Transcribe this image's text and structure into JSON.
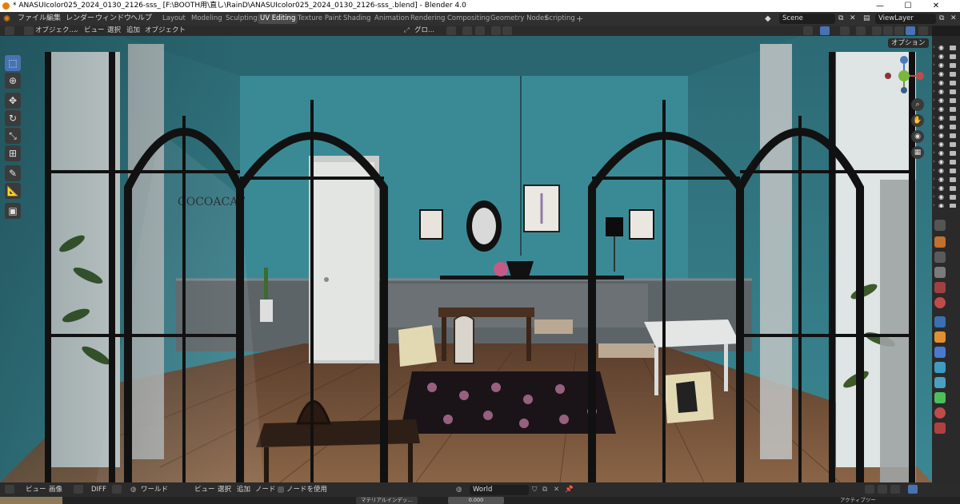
{
  "window": {
    "title": "* ANASUIcolor025_2024_0130_2126-sss_ [F:\\BOOTH用\\直し\\RainD\\ANASUIcolor025_2024_0130_2126-sss_.blend] - Blender 4.0",
    "minimize": "—",
    "maximize": "☐",
    "close": "✕"
  },
  "menu": {
    "file": "ファイル",
    "edit": "編集",
    "render": "レンダー",
    "window": "ウィンドウ",
    "help": "ヘルプ"
  },
  "workspaces": [
    "Layout",
    "Modeling",
    "Sculpting",
    "UV Editing",
    "Texture Paint",
    "Shading",
    "Animation",
    "Rendering",
    "Compositing",
    "Geometry Nodes",
    "Scripting"
  ],
  "workspace_add": "+",
  "scene": {
    "name": "Scene",
    "view_layer": "ViewLayer"
  },
  "viewport_header": {
    "mode": "オブジェク...",
    "view": "ビュー",
    "select": "選択",
    "add": "追加",
    "object": "オブジェクト",
    "transform_orientation": "グロ...",
    "options": "オプション"
  },
  "room": {
    "wall_sign": "COCOACAT"
  },
  "bottom_header": {
    "view": "ビュー",
    "image": "画像",
    "diff": "DIFF",
    "world_type": "ワールド",
    "view2": "ビュー",
    "select": "選択",
    "add": "追加",
    "node": "ノード",
    "use_nodes": "ノードを使用",
    "world_name": "World",
    "material_index": "マテリアルインデッ...",
    "value": "0.000",
    "active_tool": "アクティブツー"
  },
  "colors": {
    "accent": "#4772b3",
    "wall": "#2f6f78",
    "floor": "#6b4a34",
    "header": "#2b2b2b"
  }
}
